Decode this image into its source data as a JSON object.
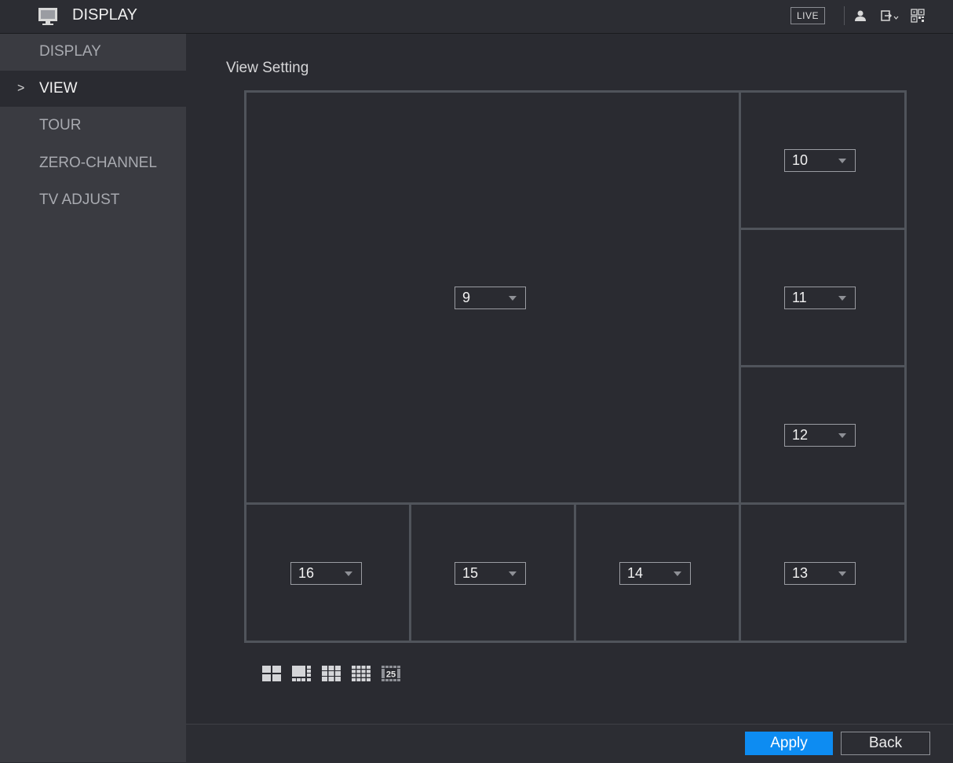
{
  "topbar": {
    "title": "DISPLAY",
    "live_label": "LIVE",
    "icons": [
      "monitor-icon",
      "user-icon",
      "logout-icon",
      "qr-code-icon"
    ]
  },
  "sidebar": {
    "items": [
      {
        "label": "DISPLAY",
        "active": false
      },
      {
        "label": "VIEW",
        "active": true
      },
      {
        "label": "TOUR",
        "active": false
      },
      {
        "label": "ZERO-CHANNEL",
        "active": false
      },
      {
        "label": "TV ADJUST",
        "active": false
      }
    ],
    "caret": ">"
  },
  "main": {
    "section_title": "View Setting",
    "windows": {
      "main": "9",
      "right_1": "10",
      "right_2": "11",
      "right_3": "12",
      "bottom_1": "16",
      "bottom_2": "15",
      "bottom_3": "14",
      "bottom_4": "13"
    },
    "layout_options": [
      "4-split",
      "8-split",
      "9-split",
      "16-split",
      "25-split"
    ],
    "layout_25_label": "25"
  },
  "footer": {
    "apply_label": "Apply",
    "back_label": "Back"
  },
  "colors": {
    "accent": "#0d8cf2",
    "background": "#2a2b31",
    "sidebar": "#3a3b41",
    "grid_border": "#50545b"
  }
}
